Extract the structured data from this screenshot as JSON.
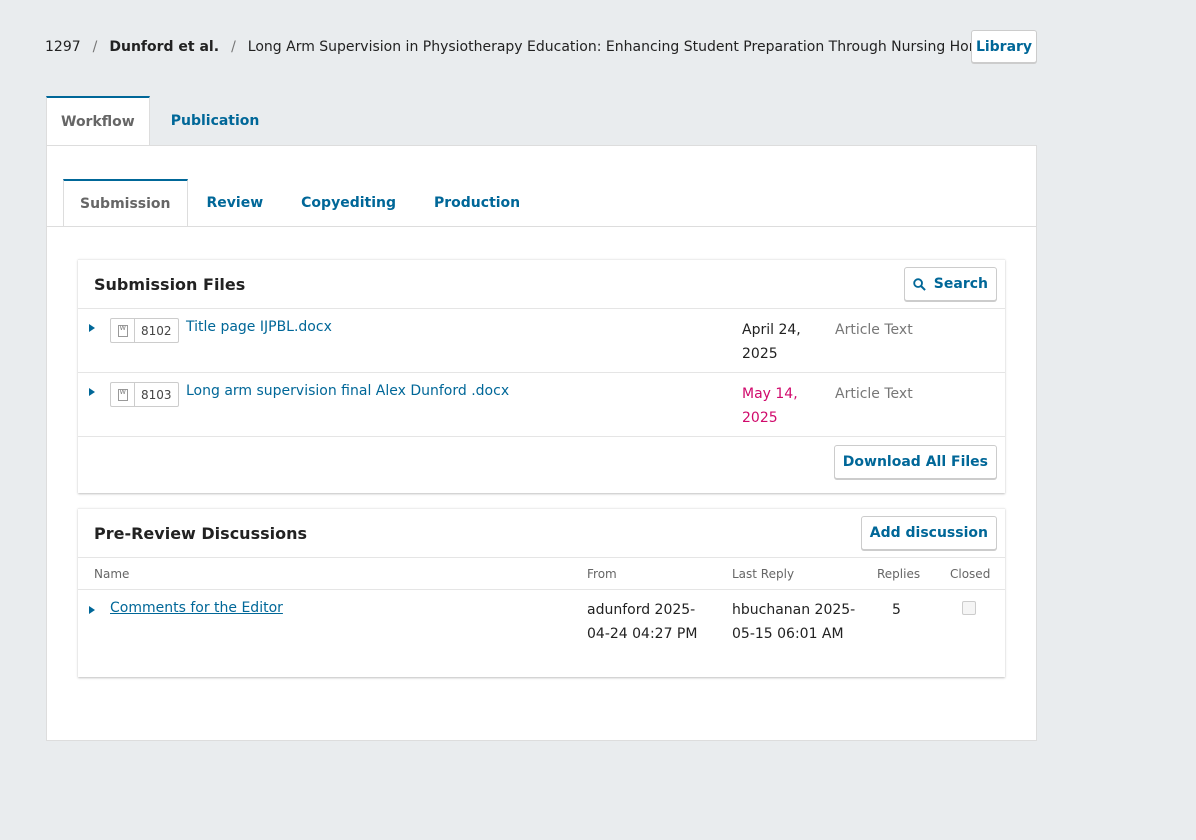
{
  "breadcrumb": {
    "id": "1297",
    "authors": "Dunford et al.",
    "title": "Long Arm Supervision in Physiotherapy Education: Enhancing Student Preparation Through Nursing Home Placements",
    "separator": "/"
  },
  "library_button": "Library",
  "top_tabs": [
    "Workflow",
    "Publication"
  ],
  "stage_tabs": [
    "Submission",
    "Review",
    "Copyediting",
    "Production"
  ],
  "submission_files": {
    "title": "Submission Files",
    "search_label": "Search",
    "files": [
      {
        "id": "8102",
        "name": "Title page IJPBL.docx",
        "date": "April 24, 2025",
        "type": "Article Text"
      },
      {
        "id": "8103",
        "name": "Long arm supervision final Alex Dunford .docx",
        "date": "May 14, 2025",
        "type": "Article Text"
      }
    ],
    "download_all_label": "Download All Files"
  },
  "discussions": {
    "title": "Pre-Review Discussions",
    "add_label": "Add discussion",
    "columns": {
      "name": "Name",
      "from": "From",
      "last_reply": "Last Reply",
      "replies": "Replies",
      "closed": "Closed"
    },
    "rows": [
      {
        "name": "Comments for the Editor",
        "from": "adunford 2025-04-24 04:27 PM",
        "last_reply": "hbuchanan 2025-05-15 06:01 AM",
        "replies": "5",
        "closed": false
      }
    ]
  },
  "colors": {
    "link": "#006798",
    "highlight_date": "#d00a6c",
    "background": "#e9ecee"
  }
}
